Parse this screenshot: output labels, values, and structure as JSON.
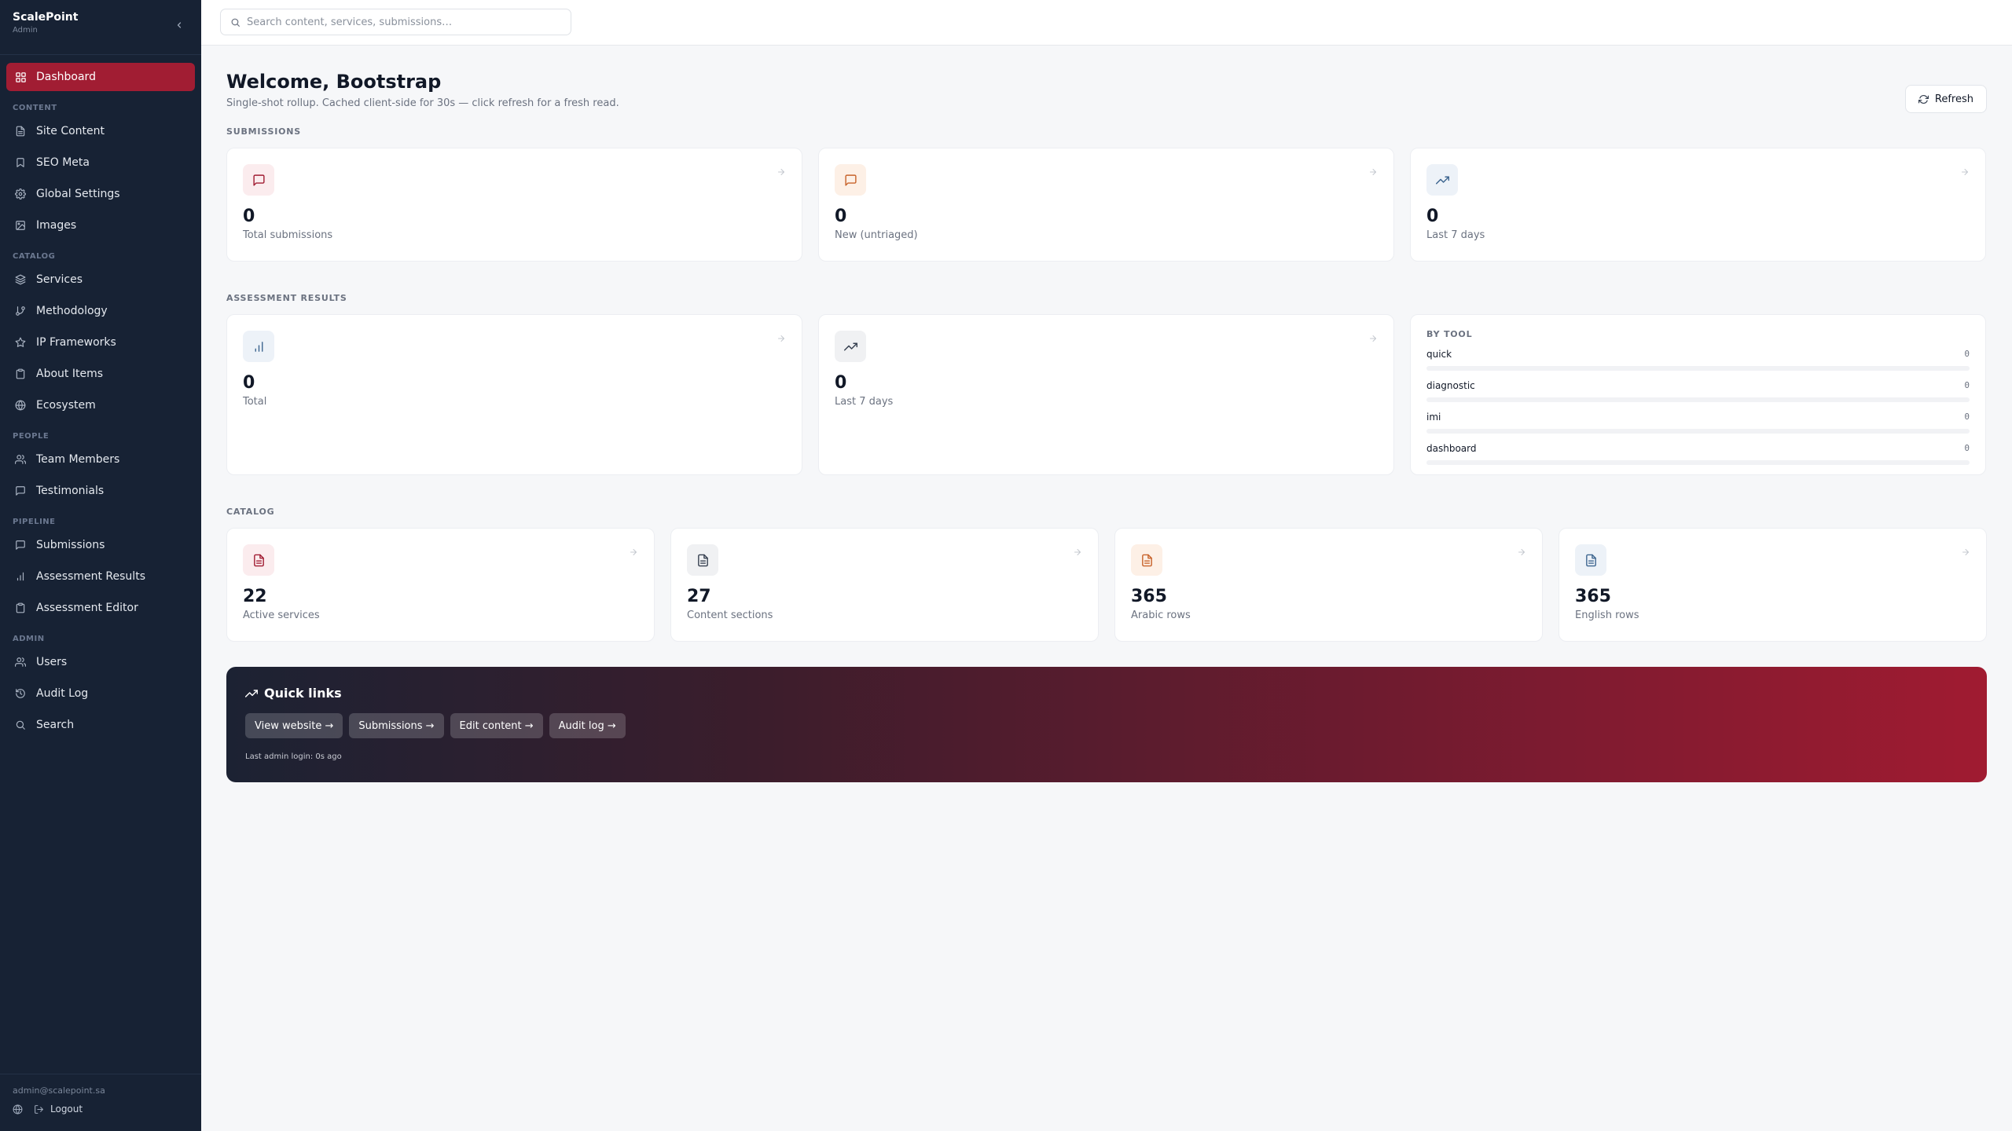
{
  "app": {
    "name": "ScalePoint",
    "role": "Admin"
  },
  "sidebar": {
    "dashboard": {
      "label": "Dashboard",
      "icon": "grid-icon"
    },
    "sections": [
      {
        "title": "Content",
        "items": [
          {
            "label": "Site Content",
            "icon": "file-text-icon"
          },
          {
            "label": "SEO Meta",
            "icon": "bookmark-icon"
          },
          {
            "label": "Global Settings",
            "icon": "gear-icon"
          },
          {
            "label": "Images",
            "icon": "image-icon"
          }
        ]
      },
      {
        "title": "Catalog",
        "items": [
          {
            "label": "Services",
            "icon": "layers-icon"
          },
          {
            "label": "Methodology",
            "icon": "git-branch-icon"
          },
          {
            "label": "IP Frameworks",
            "icon": "star-icon"
          },
          {
            "label": "About Items",
            "icon": "clipboard-icon"
          },
          {
            "label": "Ecosystem",
            "icon": "globe-icon"
          }
        ]
      },
      {
        "title": "People",
        "items": [
          {
            "label": "Team Members",
            "icon": "users-icon"
          },
          {
            "label": "Testimonials",
            "icon": "message-icon"
          }
        ]
      },
      {
        "title": "Pipeline",
        "items": [
          {
            "label": "Submissions",
            "icon": "message-icon"
          },
          {
            "label": "Assessment Results",
            "icon": "bar-chart-icon"
          },
          {
            "label": "Assessment Editor",
            "icon": "clipboard-icon"
          }
        ]
      },
      {
        "title": "Admin",
        "items": [
          {
            "label": "Users",
            "icon": "users-icon"
          },
          {
            "label": "Audit Log",
            "icon": "history-icon"
          },
          {
            "label": "Search",
            "icon": "search-icon"
          }
        ]
      }
    ],
    "footer": {
      "email": "admin@scalepoint.sa",
      "logout": "Logout"
    }
  },
  "search": {
    "placeholder": "Search content, services, submissions…"
  },
  "header": {
    "title": "Welcome, Bootstrap",
    "subtitle": "Single-shot rollup. Cached client-side for 30s — click refresh for a fresh read.",
    "refresh_label": "Refresh"
  },
  "submissions": {
    "title": "Submissions",
    "cards": [
      {
        "value": "0",
        "label": "Total submissions",
        "icon": "message-icon",
        "tone": "red"
      },
      {
        "value": "0",
        "label": "New (untriaged)",
        "icon": "message-icon",
        "tone": "orange"
      },
      {
        "value": "0",
        "label": "Last 7 days",
        "icon": "trending-up-icon",
        "tone": "blue"
      }
    ]
  },
  "assessment": {
    "title": "Assessment Results",
    "cards": [
      {
        "value": "0",
        "label": "Total",
        "icon": "bar-chart-icon",
        "tone": "blue"
      },
      {
        "value": "0",
        "label": "Last 7 days",
        "icon": "trending-up-icon",
        "tone": "gray"
      }
    ],
    "by_tool": {
      "title": "By tool",
      "rows": [
        {
          "name": "quick",
          "count": "0",
          "fraction": 0
        },
        {
          "name": "diagnostic",
          "count": "0",
          "fraction": 0
        },
        {
          "name": "imi",
          "count": "0",
          "fraction": 0
        },
        {
          "name": "dashboard",
          "count": "0",
          "fraction": 0
        }
      ]
    }
  },
  "catalog": {
    "title": "Catalog",
    "cards": [
      {
        "value": "22",
        "label": "Active services",
        "icon": "file-text-icon",
        "tone": "red"
      },
      {
        "value": "27",
        "label": "Content sections",
        "icon": "file-text-icon",
        "tone": "gray"
      },
      {
        "value": "365",
        "label": "Arabic rows",
        "icon": "file-text-icon",
        "tone": "orange"
      },
      {
        "value": "365",
        "label": "English rows",
        "icon": "file-text-icon",
        "tone": "blue"
      }
    ]
  },
  "quick_links": {
    "title": "Quick links",
    "links": [
      {
        "label": "View website →"
      },
      {
        "label": "Submissions →"
      },
      {
        "label": "Edit content →"
      },
      {
        "label": "Audit log →"
      }
    ],
    "note": "Last admin login: 0s ago"
  },
  "colors": {
    "sidebar_bg": "#172234",
    "accent": "#a11d33",
    "page_bg": "#f6f7f9"
  }
}
